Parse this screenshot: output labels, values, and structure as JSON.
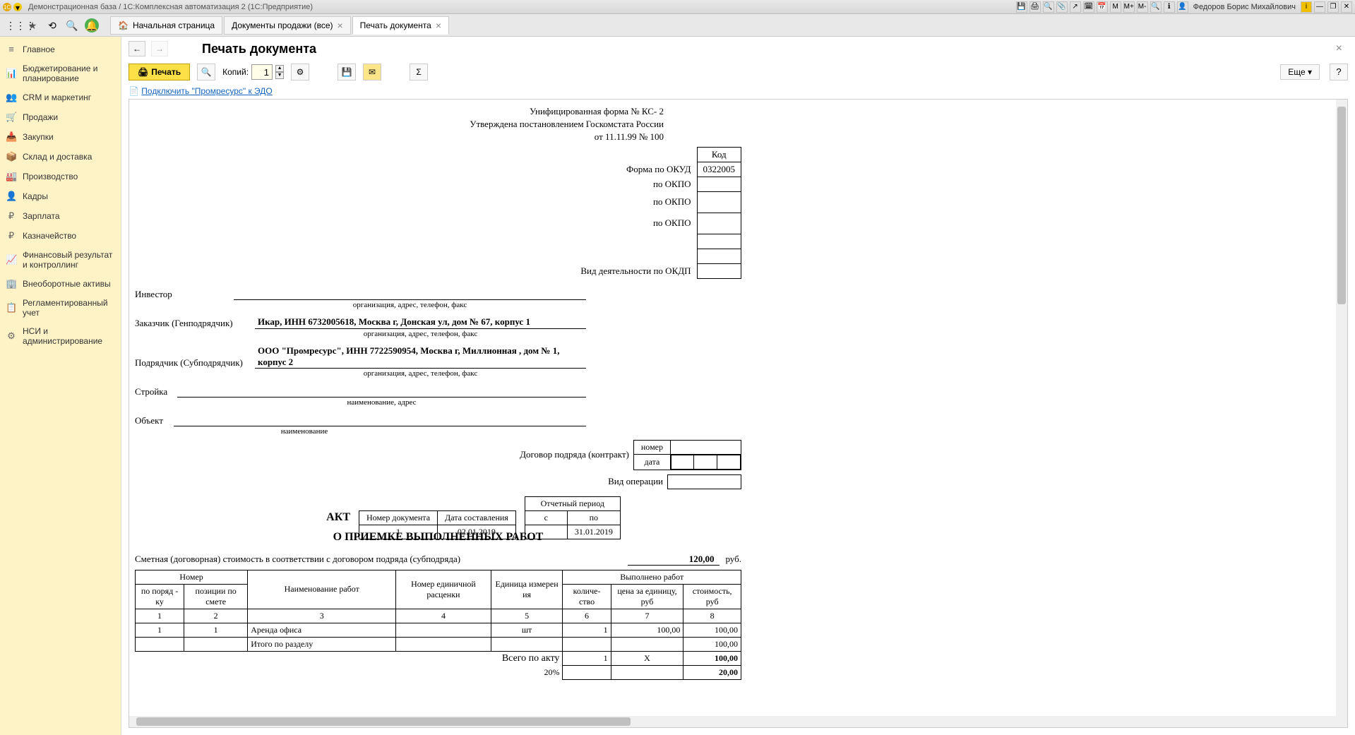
{
  "titlebar": {
    "title": "Демонстрационная база / 1С:Комплексная автоматизация 2  (1С:Предприятие)",
    "user": "Федоров Борис Михайлович"
  },
  "toolbar_icons": [
    "save",
    "print",
    "preview",
    "attach",
    "arrow",
    "calc",
    "calendar",
    "M",
    "M+",
    "M-",
    "zoom",
    "info"
  ],
  "tabs": [
    {
      "label": "Начальная страница",
      "icon": "🏠",
      "closeable": false
    },
    {
      "label": "Документы продажи (все)",
      "closeable": true
    },
    {
      "label": "Печать документа",
      "closeable": true,
      "active": true
    }
  ],
  "sidebar": [
    {
      "icon": "≡",
      "label": "Главное"
    },
    {
      "icon": "📊",
      "label": "Бюджетирование и планирование"
    },
    {
      "icon": "👥",
      "label": "CRM и маркетинг"
    },
    {
      "icon": "🛒",
      "label": "Продажи"
    },
    {
      "icon": "📥",
      "label": "Закупки"
    },
    {
      "icon": "📦",
      "label": "Склад и доставка"
    },
    {
      "icon": "🏭",
      "label": "Производство"
    },
    {
      "icon": "👤",
      "label": "Кадры"
    },
    {
      "icon": "₽",
      "label": "Зарплата"
    },
    {
      "icon": "₽",
      "label": "Казначейство"
    },
    {
      "icon": "📈",
      "label": "Финансовый результат и контроллинг"
    },
    {
      "icon": "🏢",
      "label": "Внеоборотные активы"
    },
    {
      "icon": "📋",
      "label": "Регламентированный учет"
    },
    {
      "icon": "⚙",
      "label": "НСИ и администрирование"
    }
  ],
  "page": {
    "title": "Печать документа",
    "print_label": "Печать",
    "copies_label": "Копий:",
    "copies_value": "1",
    "more_label": "Еще ▾",
    "help_label": "?",
    "edo_link": "Подключить \"Промресурс\" к ЭДО"
  },
  "doc": {
    "form_line1": "Унифицированная форма № КС- 2",
    "form_line2": "Утверждена постановлением Госкомстата России",
    "form_line3": "от 11.11.99 № 100",
    "code_label": "Код",
    "okud_label": "Форма по ОКУД",
    "okud_code": "0322005",
    "investor_label": "Инвестор",
    "okpo_label": "по ОКПО",
    "org_hint": "организация, адрес, телефон, факс",
    "customer_label": "Заказчик (Генподрядчик)",
    "customer_value": "Икар, ИНН 6732005618, Москва г, Донская ул, дом № 67, корпус 1",
    "contractor_label": "Подрядчик (Субподрядчик)",
    "contractor_value": "ООО \"Промресурс\", ИНН 7722590954, Москва г, Миллионная , дом № 1, корпус 2",
    "stroika_label": "Стройка",
    "stroika_hint": "наименование, адрес",
    "object_label": "Объект",
    "object_hint": "наименование",
    "okdp_label": "Вид деятельности по ОКДП",
    "contract_label": "Договор подряда (контракт)",
    "number_label": "номер",
    "date_label": "дата",
    "operation_label": "Вид операции",
    "doc_num_label": "Номер документа",
    "doc_date_label": "Дата составления",
    "doc_num": "1",
    "doc_date": "02.01.2019",
    "period_label": "Отчетный период",
    "period_from": "с",
    "period_to": "по",
    "period_to_val": "31.01.2019",
    "act_title1": "АКТ",
    "act_title2": "О ПРИЕМКЕ ВЫПОЛНЕННЫХ РАБОТ",
    "cost_label": "Сметная (договорная) стоимость в соответствии с договором подряда (субподряда)",
    "cost_value": "120,00",
    "cost_unit": "руб.",
    "th_number": "Номер",
    "th_order": "по поряд - ку",
    "th_pos": "позиции по смете",
    "th_name": "Наименование работ",
    "th_unit_price": "Номер единичной расценки",
    "th_unit": "Единица измерен ия",
    "th_done": "Выполнено работ",
    "th_qty": "количе- ство",
    "th_price": "цена за единицу, руб",
    "th_cost": "стоимость,   руб",
    "cols": [
      "1",
      "2",
      "3",
      "4",
      "5",
      "6",
      "7",
      "8"
    ],
    "rows": [
      {
        "n": "1",
        "pos": "1",
        "name": "Аренда офиса",
        "unitprice": "",
        "unit": "шт",
        "qty": "1",
        "price": "100,00",
        "cost": "100,00"
      }
    ],
    "subtotal_label": "Итого по разделу",
    "subtotal_cost": "100,00",
    "total_label": "Всего по акту",
    "total_qty": "1",
    "total_x": "X",
    "total_cost": "100,00",
    "vat_label": "20%",
    "vat_cost": "20,00"
  }
}
